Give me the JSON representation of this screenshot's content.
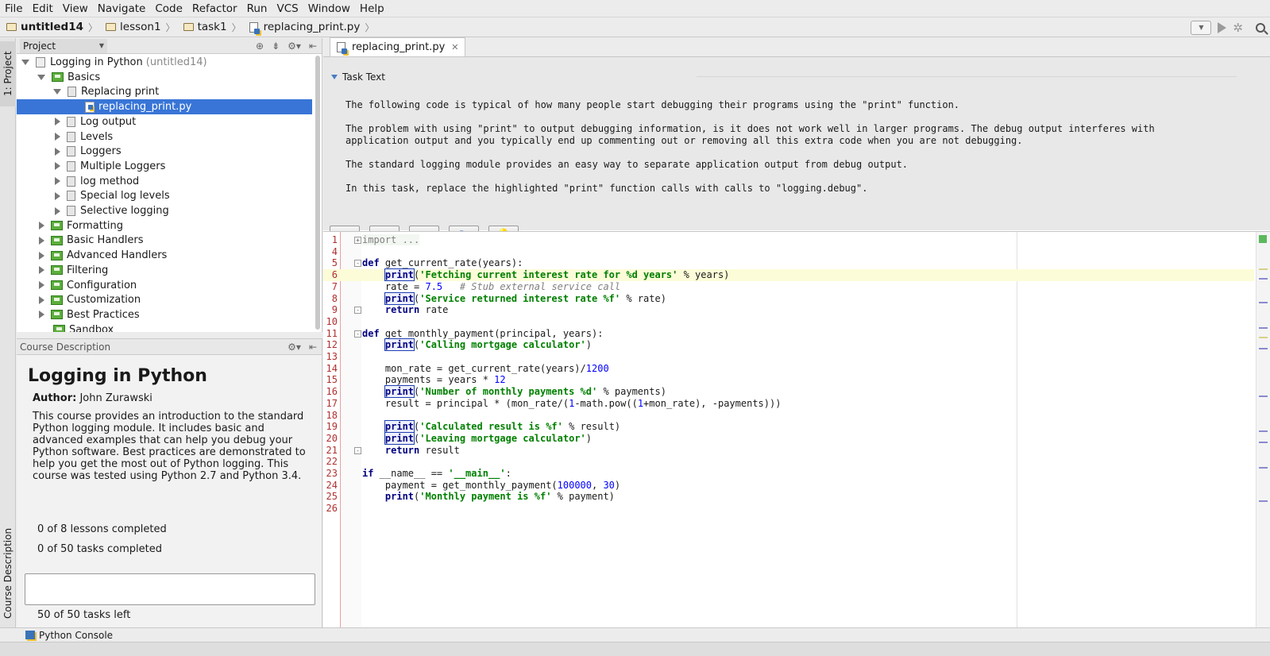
{
  "menu": [
    "File",
    "Edit",
    "View",
    "Navigate",
    "Code",
    "Refactor",
    "Run",
    "VCS",
    "Window",
    "Help"
  ],
  "breadcrumbs": [
    {
      "label": "untitled14",
      "icon": "folder-icon",
      "bold": true
    },
    {
      "label": "lesson1",
      "icon": "folder-icon"
    },
    {
      "label": "task1",
      "icon": "folder-icon"
    },
    {
      "label": "replacing_print.py",
      "icon": "python-file-icon"
    }
  ],
  "left_tabs": {
    "project": "1: Project",
    "course": "Course Description"
  },
  "project_panel": {
    "title": "Project"
  },
  "tree": [
    {
      "label": "Logging in Python",
      "extra": "(untitled14)",
      "level": 0,
      "open": true,
      "icon": "course"
    },
    {
      "label": "Basics",
      "level": 1,
      "open": true,
      "icon": "lesson"
    },
    {
      "label": "Replacing print",
      "level": 2,
      "open": true,
      "icon": "task"
    },
    {
      "label": "replacing_print.py",
      "level": 3,
      "icon": "py",
      "selected": true
    },
    {
      "label": "Log output",
      "level": 2,
      "open": false,
      "icon": "task"
    },
    {
      "label": "Levels",
      "level": 2,
      "open": false,
      "icon": "task"
    },
    {
      "label": "Loggers",
      "level": 2,
      "open": false,
      "icon": "task"
    },
    {
      "label": "Multiple Loggers",
      "level": 2,
      "open": false,
      "icon": "task"
    },
    {
      "label": "log method",
      "level": 2,
      "open": false,
      "icon": "task"
    },
    {
      "label": "Special log levels",
      "level": 2,
      "open": false,
      "icon": "task"
    },
    {
      "label": "Selective logging",
      "level": 2,
      "open": false,
      "icon": "task"
    },
    {
      "label": "Formatting",
      "level": 1,
      "open": false,
      "icon": "lesson"
    },
    {
      "label": "Basic Handlers",
      "level": 1,
      "open": false,
      "icon": "lesson"
    },
    {
      "label": "Advanced Handlers",
      "level": 1,
      "open": false,
      "icon": "lesson"
    },
    {
      "label": "Filtering",
      "level": 1,
      "open": false,
      "icon": "lesson"
    },
    {
      "label": "Configuration",
      "level": 1,
      "open": false,
      "icon": "lesson"
    },
    {
      "label": "Customization",
      "level": 1,
      "open": false,
      "icon": "lesson"
    },
    {
      "label": "Best Practices",
      "level": 1,
      "open": false,
      "icon": "lesson"
    },
    {
      "label": "Sandbox",
      "level": 1,
      "icon": "sandbox"
    }
  ],
  "course": {
    "header": "Course Description",
    "title": "Logging in Python",
    "author_label": "Author:",
    "author": "John Zurawski",
    "description": "This course provides an introduction to the standard Python logging module. It includes basic and advanced examples that can help you debug your Python software. Best practices are demonstrated to help you get the most out of Python logging. This course was tested using Python 2.7 and Python 3.4.",
    "lessons_completed": "0 of 8 lessons completed",
    "tasks_completed": "0 of 50 tasks completed",
    "progress": 0,
    "tasks_left": "50 of 50 tasks left"
  },
  "editor": {
    "tab": "replacing_print.py",
    "task_header": "Task Text",
    "task_paragraphs": [
      "The following code is typical of how many people start debugging their programs using the \"print\" function.",
      "The problem with using \"print\" to output debugging information, is it does not work well in larger programs. The debug output interferes with application output and you typically end up commenting out or removing all this extra code when you are not debugging.",
      "The standard logging module provides an easy way to separate application output from debug output.",
      "In this task, replace the highlighted \"print\" function calls with calls to \"logging.debug\"."
    ],
    "buttons": [
      {
        "name": "check-button",
        "icon": "check-icon",
        "glyph": "✔"
      },
      {
        "name": "prev-task-button",
        "icon": "arrow-left-icon",
        "glyph": "⇦"
      },
      {
        "name": "next-task-button",
        "icon": "arrow-right-icon",
        "glyph": "⇨"
      },
      {
        "name": "refresh-task-button",
        "icon": "refresh-icon",
        "glyph": "↻"
      },
      {
        "name": "hint-button",
        "icon": "lightbulb-icon",
        "glyph": "💡"
      }
    ],
    "code": [
      {
        "n": "1",
        "fold": "+",
        "t": [
          [
            "imp",
            "import ..."
          ]
        ]
      },
      {
        "n": "4",
        "t": []
      },
      {
        "n": "5",
        "fold": "-",
        "t": [
          [
            "kw",
            "def"
          ],
          [
            "",
            "get_current_rate(years):"
          ]
        ]
      },
      {
        "n": "6",
        "hl": true,
        "t": [
          [
            "",
            "    "
          ],
          [
            "pr",
            "print"
          ],
          [
            "",
            "("
          ],
          [
            "st",
            "'Fetching current interest rate for %d years'"
          ],
          [
            "",
            " % years)"
          ]
        ]
      },
      {
        "n": "7",
        "t": [
          [
            "",
            "    rate = "
          ],
          [
            "nm",
            "7.5"
          ],
          [
            "",
            "   "
          ],
          [
            "cm",
            "# Stub external service call"
          ]
        ]
      },
      {
        "n": "8",
        "t": [
          [
            "",
            "    "
          ],
          [
            "pr",
            "print"
          ],
          [
            "",
            "("
          ],
          [
            "st",
            "'Service returned interest rate %f'"
          ],
          [
            "",
            " % rate)"
          ]
        ]
      },
      {
        "n": "9",
        "fold": "-",
        "t": [
          [
            "",
            "    "
          ],
          [
            "kw",
            "return"
          ],
          [
            "",
            " rate"
          ]
        ]
      },
      {
        "n": "10",
        "t": []
      },
      {
        "n": "11",
        "fold": "-",
        "t": [
          [
            "kw",
            "def"
          ],
          [
            "",
            "get_monthly_payment(principal, years):"
          ]
        ]
      },
      {
        "n": "12",
        "t": [
          [
            "",
            "    "
          ],
          [
            "pr",
            "print"
          ],
          [
            "",
            "("
          ],
          [
            "st",
            "'Calling mortgage calculator'"
          ],
          [
            "",
            ")"
          ]
        ]
      },
      {
        "n": "13",
        "t": []
      },
      {
        "n": "14",
        "t": [
          [
            "",
            "    mon_rate = get_current_rate(years)/"
          ],
          [
            "nm",
            "1200"
          ]
        ]
      },
      {
        "n": "15",
        "t": [
          [
            "",
            "    payments = years * "
          ],
          [
            "nm",
            "12"
          ]
        ]
      },
      {
        "n": "16",
        "t": [
          [
            "",
            "    "
          ],
          [
            "pr",
            "print"
          ],
          [
            "",
            "("
          ],
          [
            "st",
            "'Number of monthly payments %d'"
          ],
          [
            "",
            " % payments)"
          ]
        ]
      },
      {
        "n": "17",
        "t": [
          [
            "",
            "    result = principal * (mon_rate/("
          ],
          [
            "nm",
            "1"
          ],
          [
            "",
            "-math.pow(("
          ],
          [
            "nm",
            "1"
          ],
          [
            "",
            "+mon_rate), -payments)))"
          ]
        ]
      },
      {
        "n": "18",
        "t": []
      },
      {
        "n": "19",
        "t": [
          [
            "",
            "    "
          ],
          [
            "pr",
            "print"
          ],
          [
            "",
            "("
          ],
          [
            "st",
            "'Calculated result is %f'"
          ],
          [
            "",
            " % result)"
          ]
        ]
      },
      {
        "n": "20",
        "t": [
          [
            "",
            "    "
          ],
          [
            "pr",
            "print"
          ],
          [
            "",
            "("
          ],
          [
            "st",
            "'Leaving mortgage calculator'"
          ],
          [
            "",
            ")"
          ]
        ]
      },
      {
        "n": "21",
        "fold": "-",
        "t": [
          [
            "",
            "    "
          ],
          [
            "kw",
            "return"
          ],
          [
            "",
            " result"
          ]
        ]
      },
      {
        "n": "22",
        "t": []
      },
      {
        "n": "23",
        "t": [
          [
            "kw",
            "if"
          ],
          [
            "",
            " __name__ == "
          ],
          [
            "st",
            "'__main__'"
          ],
          [
            "",
            ":"
          ]
        ]
      },
      {
        "n": "24",
        "t": [
          [
            "",
            "    payment = get_monthly_payment("
          ],
          [
            "nm",
            "100000"
          ],
          [
            "",
            ", "
          ],
          [
            "nm",
            "30"
          ],
          [
            "",
            ")"
          ]
        ]
      },
      {
        "n": "25",
        "t": [
          [
            "",
            "    "
          ],
          [
            "kw",
            "print"
          ],
          [
            "",
            "("
          ],
          [
            "st",
            "'Monthly payment is %f'"
          ],
          [
            "",
            " % payment)"
          ]
        ]
      },
      {
        "n": "26",
        "t": []
      }
    ]
  },
  "statusbar": {
    "console": "Python Console"
  }
}
